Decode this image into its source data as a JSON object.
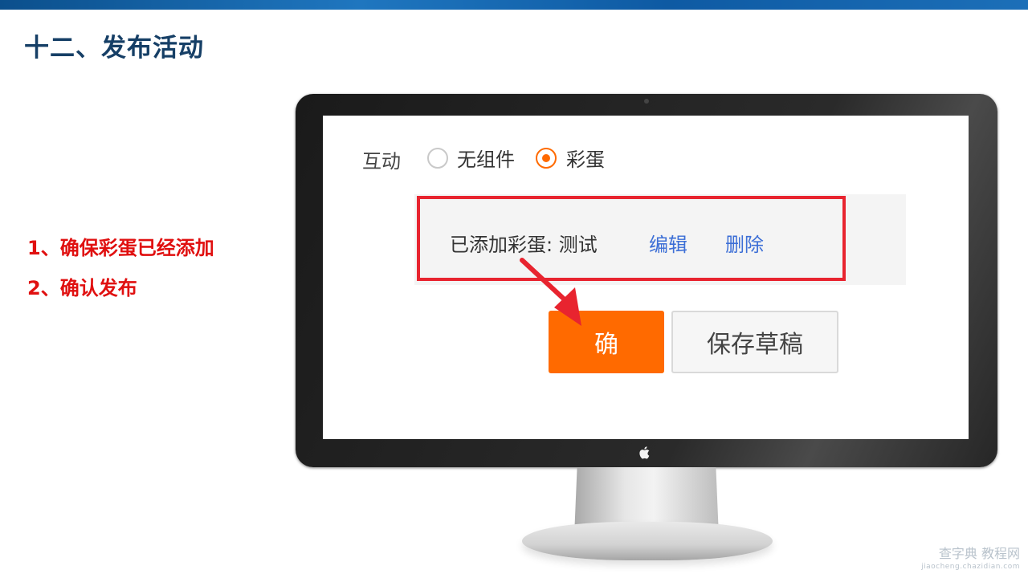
{
  "slide": {
    "title": "十二、发布活动",
    "steps": [
      "1、确保彩蛋已经添加",
      "2、确认发布"
    ]
  },
  "screen": {
    "interaction_label": "互动",
    "radio_options": [
      {
        "label": "无组件",
        "selected": false
      },
      {
        "label": "彩蛋",
        "selected": true
      }
    ],
    "egg_status_text": "已添加彩蛋: 测试",
    "edit_link": "编辑",
    "delete_link": "删除",
    "confirm_button": "确",
    "save_draft_button": "保存草稿"
  },
  "watermark": {
    "main": "查字典 教程网",
    "sub": "jiaocheng.chazidian.com"
  },
  "colors": {
    "accent_orange": "#ff6a00",
    "highlight_red": "#e8242f",
    "link_blue": "#3d6fd6",
    "step_red": "#e01010",
    "title_navy": "#163f66"
  },
  "icons": {
    "apple_logo": "apple-logo-icon",
    "arrow": "pointer-arrow-icon"
  }
}
